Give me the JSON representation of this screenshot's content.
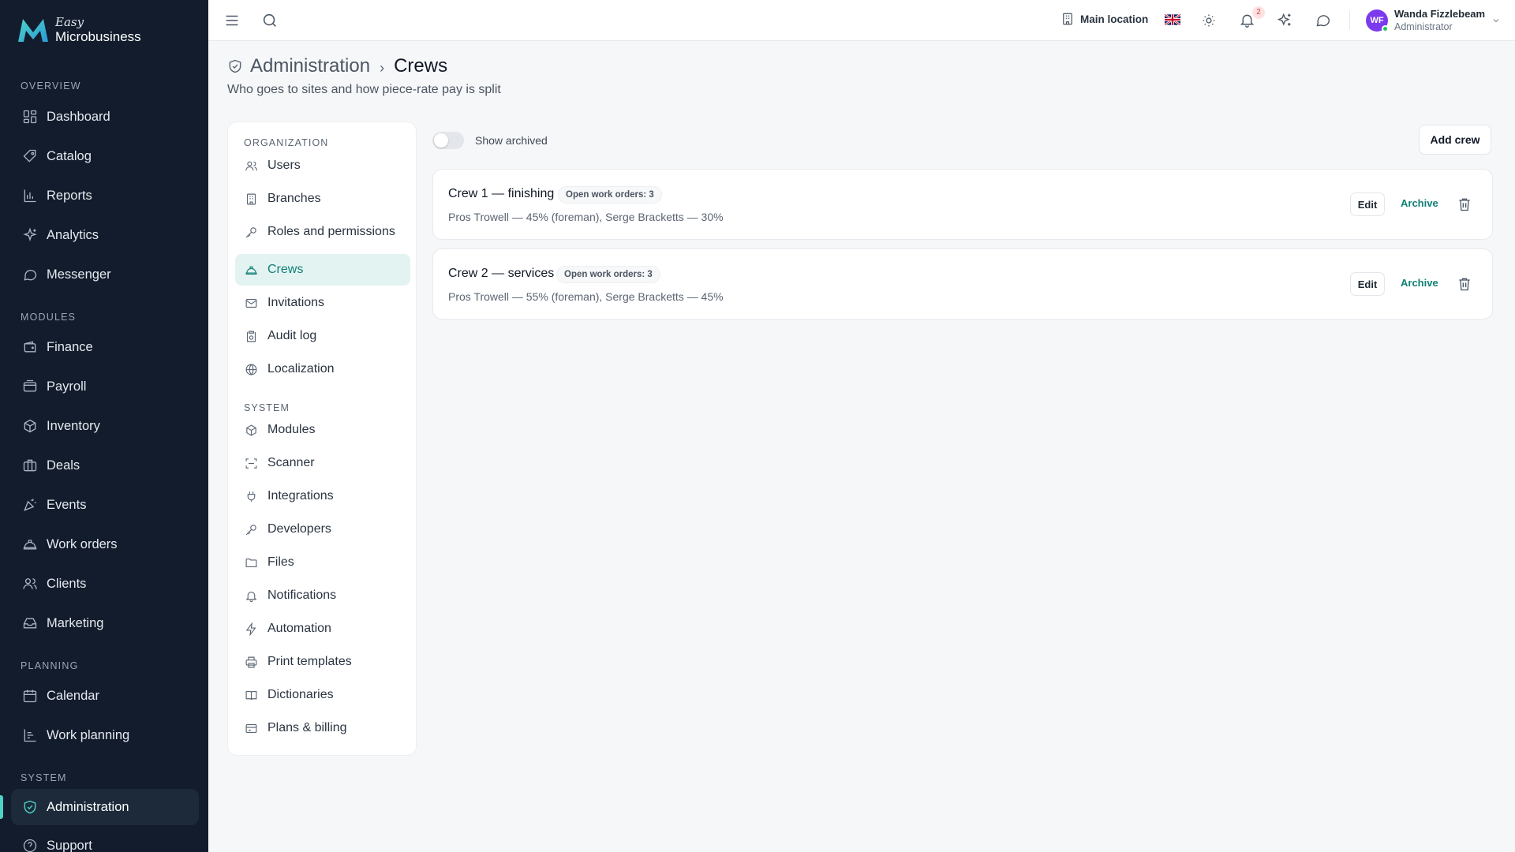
{
  "brand": {
    "easy": "Easy",
    "name": "Microbusiness",
    "colors": {
      "primary": "#0f8076",
      "accent": "#4fd1c5",
      "sidebar_bg": "#121c2c"
    }
  },
  "sidebar": {
    "sections": [
      {
        "label": "OVERVIEW",
        "items": [
          {
            "label": "Dashboard",
            "icon": "dashboard-icon"
          },
          {
            "label": "Catalog",
            "icon": "catalog-icon"
          },
          {
            "label": "Reports",
            "icon": "reports-icon"
          },
          {
            "label": "Analytics",
            "icon": "analytics-icon"
          },
          {
            "label": "Messenger",
            "icon": "messenger-icon"
          }
        ]
      },
      {
        "label": "MODULES",
        "items": [
          {
            "label": "Finance",
            "icon": "finance-icon"
          },
          {
            "label": "Payroll",
            "icon": "payroll-icon"
          },
          {
            "label": "Inventory",
            "icon": "inventory-icon"
          },
          {
            "label": "Deals",
            "icon": "deals-icon"
          },
          {
            "label": "Events",
            "icon": "events-icon"
          },
          {
            "label": "Work orders",
            "icon": "work-orders-icon"
          },
          {
            "label": "Clients",
            "icon": "clients-icon"
          },
          {
            "label": "Marketing",
            "icon": "marketing-icon"
          }
        ]
      },
      {
        "label": "PLANNING",
        "items": [
          {
            "label": "Calendar",
            "icon": "calendar-icon"
          },
          {
            "label": "Work planning",
            "icon": "work-planning-icon"
          }
        ]
      },
      {
        "label": "SYSTEM",
        "items": [
          {
            "label": "Administration",
            "icon": "shield-icon",
            "active": true
          },
          {
            "label": "Support",
            "icon": "help-icon"
          }
        ]
      }
    ]
  },
  "topbar": {
    "location": "Main location",
    "notifications_count": "2",
    "user": {
      "initials": "WF",
      "name": "Wanda Fizzlebeam",
      "role": "Administrator"
    }
  },
  "header": {
    "breadcrumb_parent": "Administration",
    "breadcrumb_separator": "›",
    "title": "Crews",
    "subtitle": "Who goes to sites and how piece-rate pay is split"
  },
  "settings_nav": {
    "sections": [
      {
        "label": "ORGANIZATION",
        "items": [
          {
            "label": "Users",
            "icon": "users-icon"
          },
          {
            "label": "Branches",
            "icon": "branches-icon"
          },
          {
            "label": "Roles and permissions",
            "icon": "key-icon"
          },
          {
            "label": "Crews",
            "icon": "crews-icon",
            "active": true
          },
          {
            "label": "Invitations",
            "icon": "mail-icon"
          },
          {
            "label": "Audit log",
            "icon": "audit-log-icon"
          },
          {
            "label": "Localization",
            "icon": "globe-icon"
          }
        ]
      },
      {
        "label": "SYSTEM",
        "items": [
          {
            "label": "Modules",
            "icon": "modules-icon"
          },
          {
            "label": "Scanner",
            "icon": "scanner-icon"
          },
          {
            "label": "Integrations",
            "icon": "plug-icon"
          },
          {
            "label": "Developers",
            "icon": "developers-key-icon"
          },
          {
            "label": "Files",
            "icon": "folder-icon"
          },
          {
            "label": "Notifications",
            "icon": "bell-icon"
          },
          {
            "label": "Automation",
            "icon": "lightning-icon"
          },
          {
            "label": "Print templates",
            "icon": "printer-icon"
          },
          {
            "label": "Dictionaries",
            "icon": "book-icon"
          },
          {
            "label": "Plans & billing",
            "icon": "credit-card-icon"
          }
        ]
      }
    ]
  },
  "toolbar": {
    "show_archived_label": "Show archived",
    "show_archived": false,
    "add_label": "Add crew"
  },
  "crews": [
    {
      "name": "Crew 1 — finishing",
      "badge": "Open work orders: 3",
      "members": "Pros Trowell — 45% (foreman), Serge Bracketts — 30%",
      "edit_label": "Edit",
      "archive_label": "Archive"
    },
    {
      "name": "Crew 2 — services",
      "badge": "Open work orders: 3",
      "members": "Pros Trowell — 55% (foreman), Serge Bracketts — 45%",
      "edit_label": "Edit",
      "archive_label": "Archive"
    }
  ]
}
